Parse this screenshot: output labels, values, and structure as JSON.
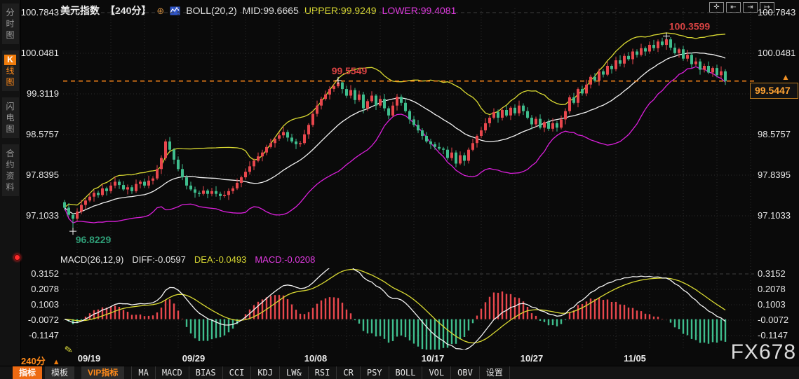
{
  "window": {
    "watermark": "FX678"
  },
  "sidebar": {
    "items": [
      {
        "label": "分时图",
        "active": false
      },
      {
        "label": "K线图",
        "active": true
      },
      {
        "label": "闪电图",
        "active": false
      },
      {
        "label": "合约资料",
        "active": false
      }
    ]
  },
  "header": {
    "symbol": "美元指数",
    "period": "【240分】",
    "collapse_glyph": "⊕",
    "boll_label": "BOLL(20,2)",
    "mid": "MID:99.6665",
    "upper": "UPPER:99.9249",
    "lower": "LOWER:99.4081"
  },
  "top_icons": [
    {
      "name": "crosshair-pan-icon",
      "glyph": "✛"
    },
    {
      "name": "zoom-in-x-icon",
      "glyph": "⇤"
    },
    {
      "name": "zoom-out-x-icon",
      "glyph": "⇥"
    },
    {
      "name": "goto-latest-icon",
      "glyph": "↦"
    }
  ],
  "main_axis": {
    "labels": [
      "100.7843",
      "100.0481",
      "99.3119",
      "98.5757",
      "97.8395",
      "97.1033"
    ]
  },
  "macd_axis": {
    "labels": [
      "0.3152",
      "0.2078",
      "0.1003",
      "-0.0072",
      "-0.1147"
    ]
  },
  "indicator_header": {
    "formula": "MACD(26,12,9)",
    "diff": "DIFF:-0.0597",
    "dea": "DEA:-0.0493",
    "macd": "MACD:-0.0208"
  },
  "xaxis": {
    "period": "240分",
    "dates": [
      "09/19",
      "09/29",
      "10/08",
      "10/17",
      "10/27",
      "11/05"
    ]
  },
  "price_line": {
    "value": "99.5447"
  },
  "annotations": [
    {
      "text": "99.5549",
      "color": "#d94343",
      "candle_index": 65,
      "type": "high",
      "dx": 16,
      "dy": -9
    },
    {
      "text": "100.3599",
      "color": "#d94343",
      "candle_index": 143,
      "type": "high",
      "dx": 33,
      "dy": -9
    },
    {
      "text": "96.8229",
      "color": "#2f9e77",
      "candle_index": 2,
      "type": "low",
      "dx": 29,
      "dy": 17
    }
  ],
  "bottom_toolbar": {
    "tabs": [
      {
        "label": "指标",
        "active": true,
        "vip": false
      },
      {
        "label": "模板",
        "active": false,
        "vip": false
      },
      {
        "label": "VIP指标",
        "active": false,
        "vip": true
      }
    ],
    "indicators": [
      "MA",
      "MACD",
      "BIAS",
      "CCI",
      "KDJ",
      "LW&",
      "RSI",
      "CR",
      "PSY",
      "BOLL",
      "VOL",
      "OBV",
      "设置"
    ]
  },
  "colors": {
    "up": "#e8474d",
    "down": "#3fbd8d",
    "boll_mid": "#f2f2f2",
    "boll_upper": "#d9d932",
    "boll_lower": "#da1fda",
    "macd_diff": "#f2f2f2",
    "macd_dea": "#d9d932",
    "accent_orange": "#ff8a1a",
    "period_red": "#ff4a00",
    "upper_text": "#d9d932",
    "lower_text": "#e23ae2",
    "price_line": "#f08018",
    "grid": "#2c2c2c",
    "grid_major": "#3d3d3d",
    "cross": "#f5f5f5"
  },
  "chart_data": {
    "type": "candlestick+macd",
    "symbol": "美元指数",
    "interval": "240分",
    "x_dates": [
      "09/19",
      "09/29",
      "10/08",
      "10/17",
      "10/27",
      "11/05"
    ],
    "y_range": [
      97.1033,
      100.7843
    ],
    "macd_y_range": [
      -0.1147,
      0.3152
    ],
    "session_low": 96.8229,
    "session_high": 100.3599,
    "marked_high": 99.5549,
    "last_price": 99.5447,
    "indicators": {
      "boll": {
        "period": 20,
        "mult": 2
      },
      "macd": {
        "fast": 12,
        "slow": 26,
        "signal": 9
      }
    },
    "closes": [
      97.25,
      97.12,
      97.05,
      97.18,
      97.3,
      97.38,
      97.45,
      97.52,
      97.48,
      97.6,
      97.55,
      97.65,
      97.72,
      97.66,
      97.58,
      97.62,
      97.55,
      97.68,
      97.72,
      97.65,
      97.74,
      97.78,
      97.95,
      98.15,
      98.45,
      98.3,
      98.12,
      97.95,
      97.8,
      97.65,
      97.58,
      97.52,
      97.5,
      97.56,
      97.5,
      97.55,
      97.5,
      97.46,
      97.48,
      97.55,
      97.6,
      97.7,
      97.8,
      97.9,
      98.0,
      98.1,
      98.18,
      98.25,
      98.35,
      98.42,
      98.5,
      98.56,
      98.62,
      98.52,
      98.45,
      98.4,
      98.42,
      98.58,
      98.75,
      98.95,
      99.1,
      99.22,
      99.3,
      99.4,
      99.45,
      99.52,
      99.4,
      99.28,
      99.38,
      99.2,
      99.3,
      99.05,
      99.18,
      99.28,
      99.1,
      99.22,
      99.05,
      98.92,
      99.1,
      99.26,
      99.15,
      99.0,
      98.85,
      98.75,
      98.65,
      98.55,
      98.45,
      98.4,
      98.35,
      98.32,
      98.3,
      98.15,
      98.25,
      98.05,
      98.2,
      98.1,
      98.3,
      98.42,
      98.55,
      98.65,
      98.78,
      98.88,
      98.98,
      98.88,
      99.02,
      98.92,
      99.06,
      98.96,
      99.1,
      99.0,
      98.88,
      98.76,
      98.86,
      98.7,
      98.8,
      98.68,
      98.78,
      98.7,
      98.85,
      99.0,
      99.25,
      99.15,
      99.4,
      99.32,
      99.48,
      99.62,
      99.55,
      99.72,
      99.66,
      99.82,
      99.76,
      99.92,
      99.86,
      100.0,
      99.94,
      100.08,
      100.02,
      100.14,
      100.08,
      100.2,
      100.14,
      100.26,
      100.2,
      100.3,
      100.15,
      100.05,
      100.12,
      99.95,
      100.02,
      99.85,
      99.9,
      99.75,
      99.82,
      99.7,
      99.78,
      99.65,
      99.72,
      99.545
    ],
    "wick_pattern": [
      [
        0.04,
        0.05
      ],
      [
        0.08,
        0.03
      ],
      [
        0.03,
        0.08
      ],
      [
        0.06,
        0.04
      ],
      [
        0.09,
        0.05
      ],
      [
        0.04,
        0.07
      ],
      [
        0.07,
        0.03
      ],
      [
        0.05,
        0.09
      ]
    ],
    "special_points": {
      "2": {
        "low": 96.8229
      },
      "65": {
        "high": 99.5549
      },
      "143": {
        "high": 100.3599
      }
    }
  }
}
